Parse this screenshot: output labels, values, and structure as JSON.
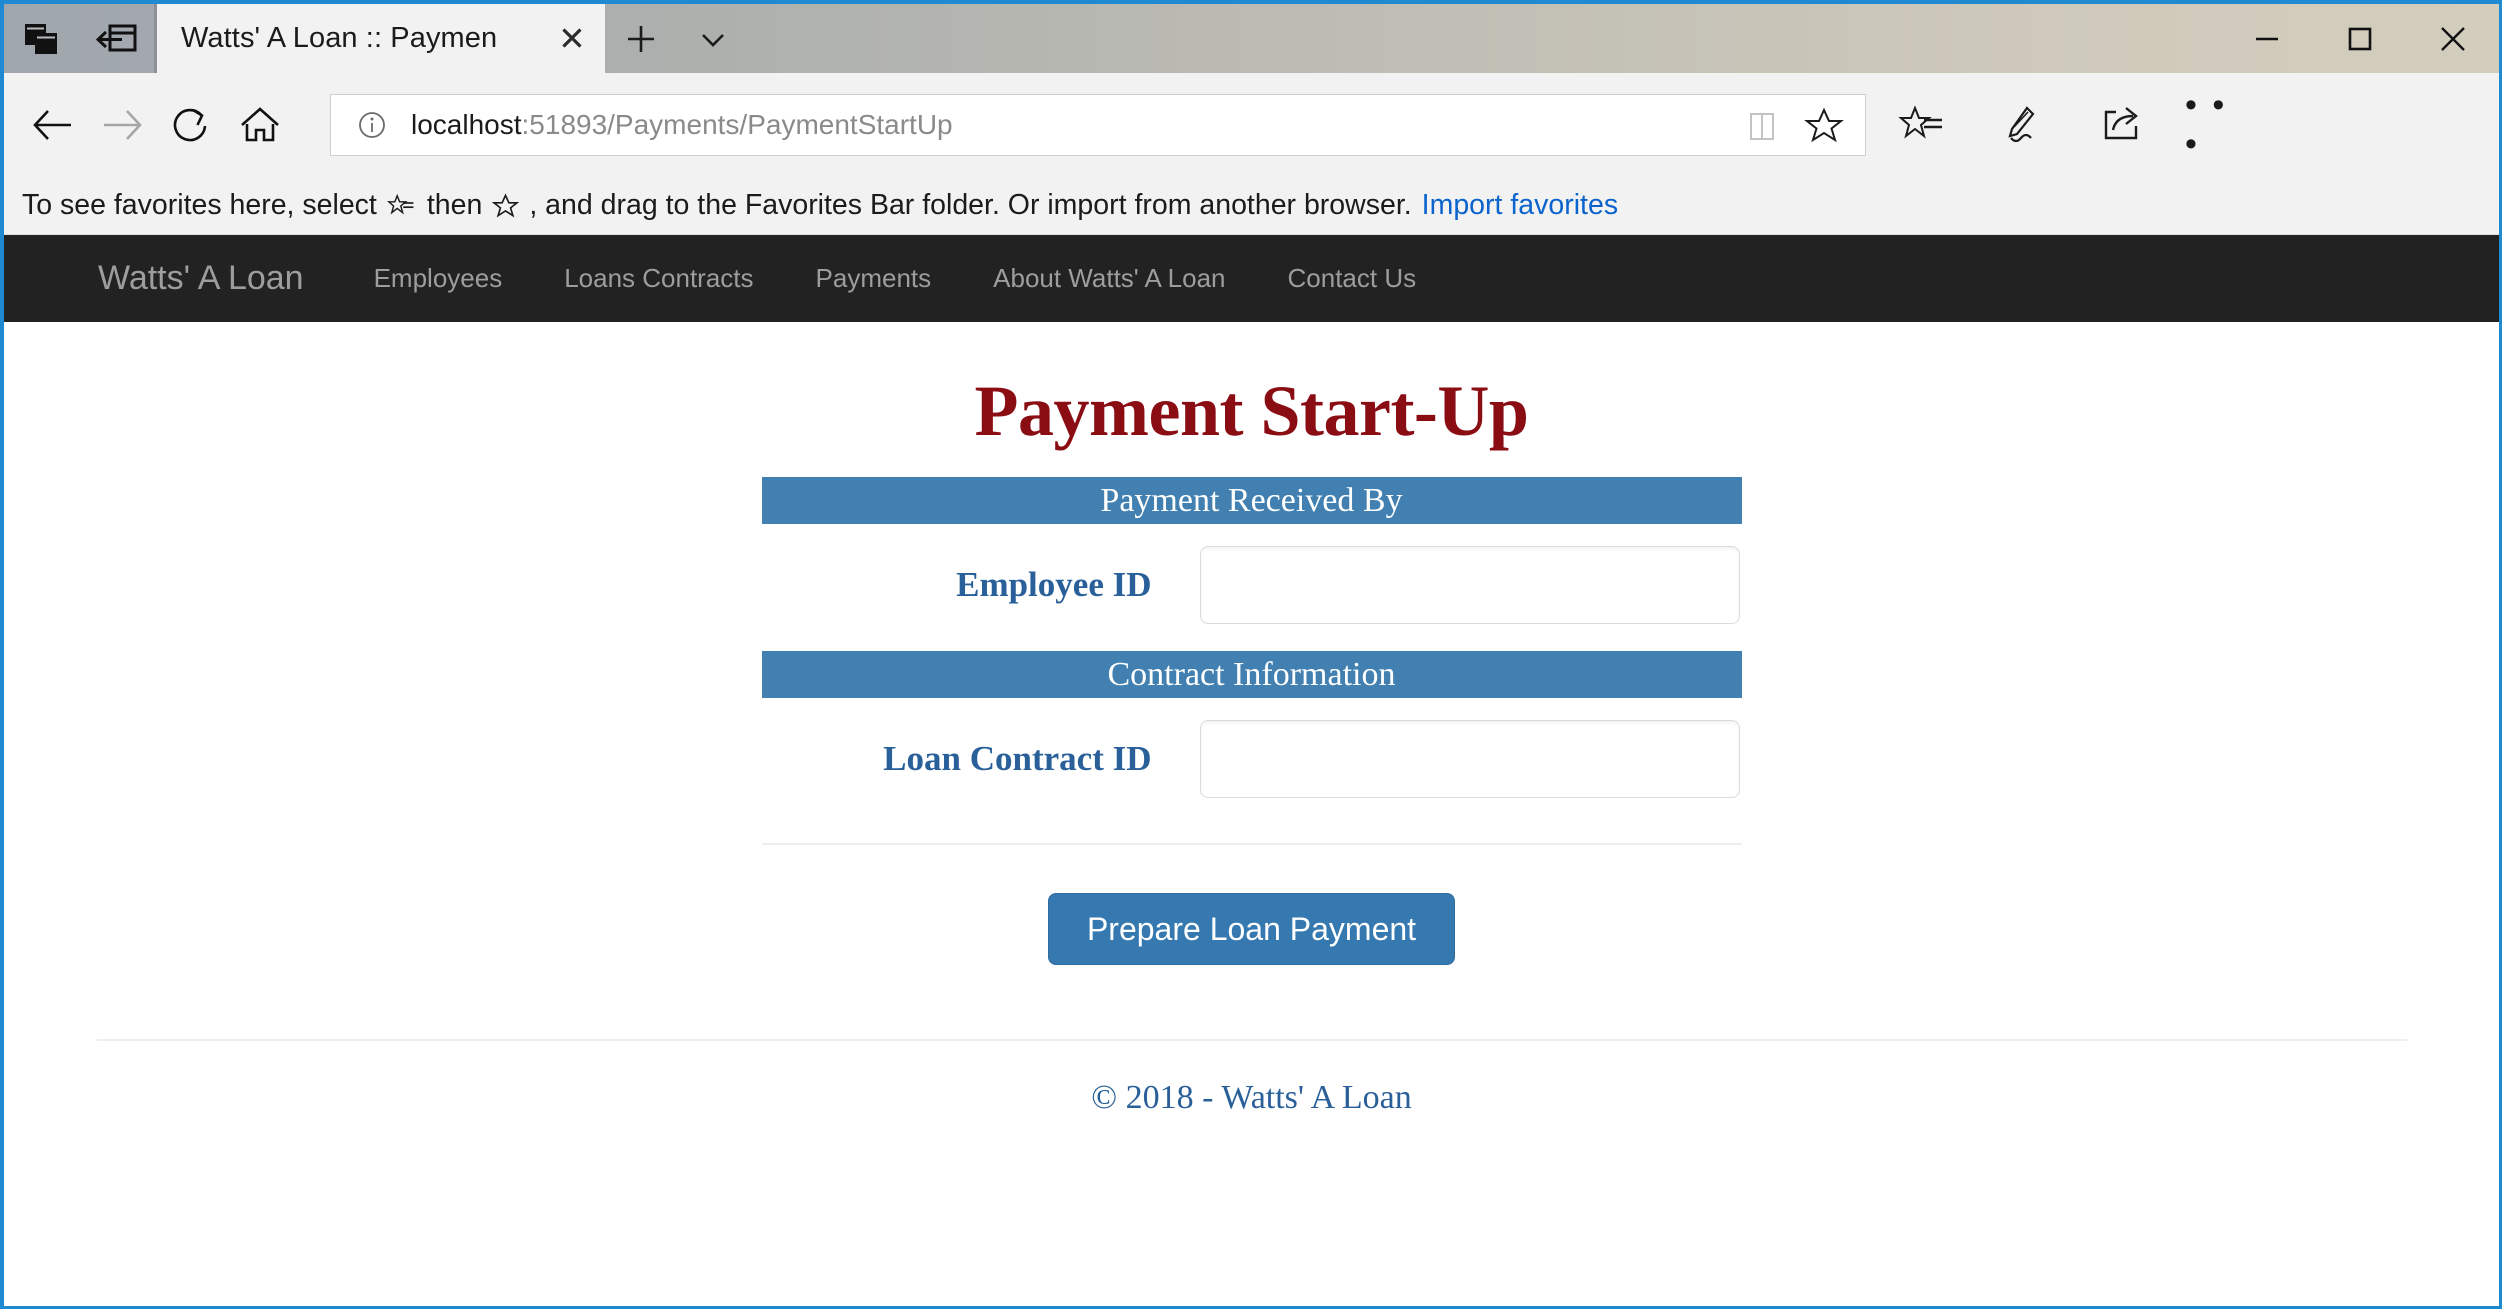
{
  "browser": {
    "window_controls": {
      "minimize_label": "—",
      "maximize_label": "□",
      "close_label": "✕"
    },
    "titlebar_icons": {
      "set_aside_tabs": "stacked-windows-icon",
      "tabs_you_set_aside": "window-back-arrow-icon"
    },
    "tab": {
      "title": "Watts' A Loan :: Paymen",
      "close_label": "✕"
    },
    "new_tab_label": "+",
    "tab_menu_label": "⌄",
    "nav": {
      "back_label": "←",
      "forward_label": "→",
      "refresh_label": "⟳",
      "home_label": "⌂"
    },
    "address": {
      "host": "localhost",
      "path": ":51893/Payments/PaymentStartUp",
      "full_url": "localhost:51893/Payments/PaymentStartUp",
      "info_icon": "info-circle-icon",
      "reading_view_icon": "book-icon",
      "favorite_icon": "star-icon"
    },
    "toolbar": {
      "hub_icon": "hub-star-list-icon",
      "web_note_icon": "pen-icon",
      "share_icon": "share-icon",
      "more_label": "• • •"
    },
    "favorites_bar": {
      "text_before_hub": "To see favorites here, select",
      "text_between": "then",
      "text_after_star": ", and drag to the Favorites Bar folder. Or import from another browser.",
      "link_label": "Import favorites"
    }
  },
  "site": {
    "brand": "Watts' A Loan",
    "nav_links": [
      {
        "label": "Employees"
      },
      {
        "label": "Loans Contracts"
      },
      {
        "label": "Payments"
      },
      {
        "label": "About Watts' A Loan"
      },
      {
        "label": "Contact Us"
      }
    ],
    "page_title": "Payment Start-Up",
    "sections": [
      {
        "heading": "Payment Received By",
        "field_label": "Employee ID",
        "field_value": "",
        "field_placeholder": ""
      },
      {
        "heading": "Contract Information",
        "field_label": "Loan Contract ID",
        "field_value": "",
        "field_placeholder": ""
      }
    ],
    "submit_button_label": "Prepare Loan Payment",
    "footer_text": "© 2018 - Watts' A Loan"
  },
  "colors": {
    "accent_blue": "#4180b0",
    "title_red": "#8b0d14",
    "label_blue": "#2a6099",
    "navbar_dark": "#222222",
    "button_blue": "#3579b0",
    "window_border": "#1f8ad2"
  }
}
